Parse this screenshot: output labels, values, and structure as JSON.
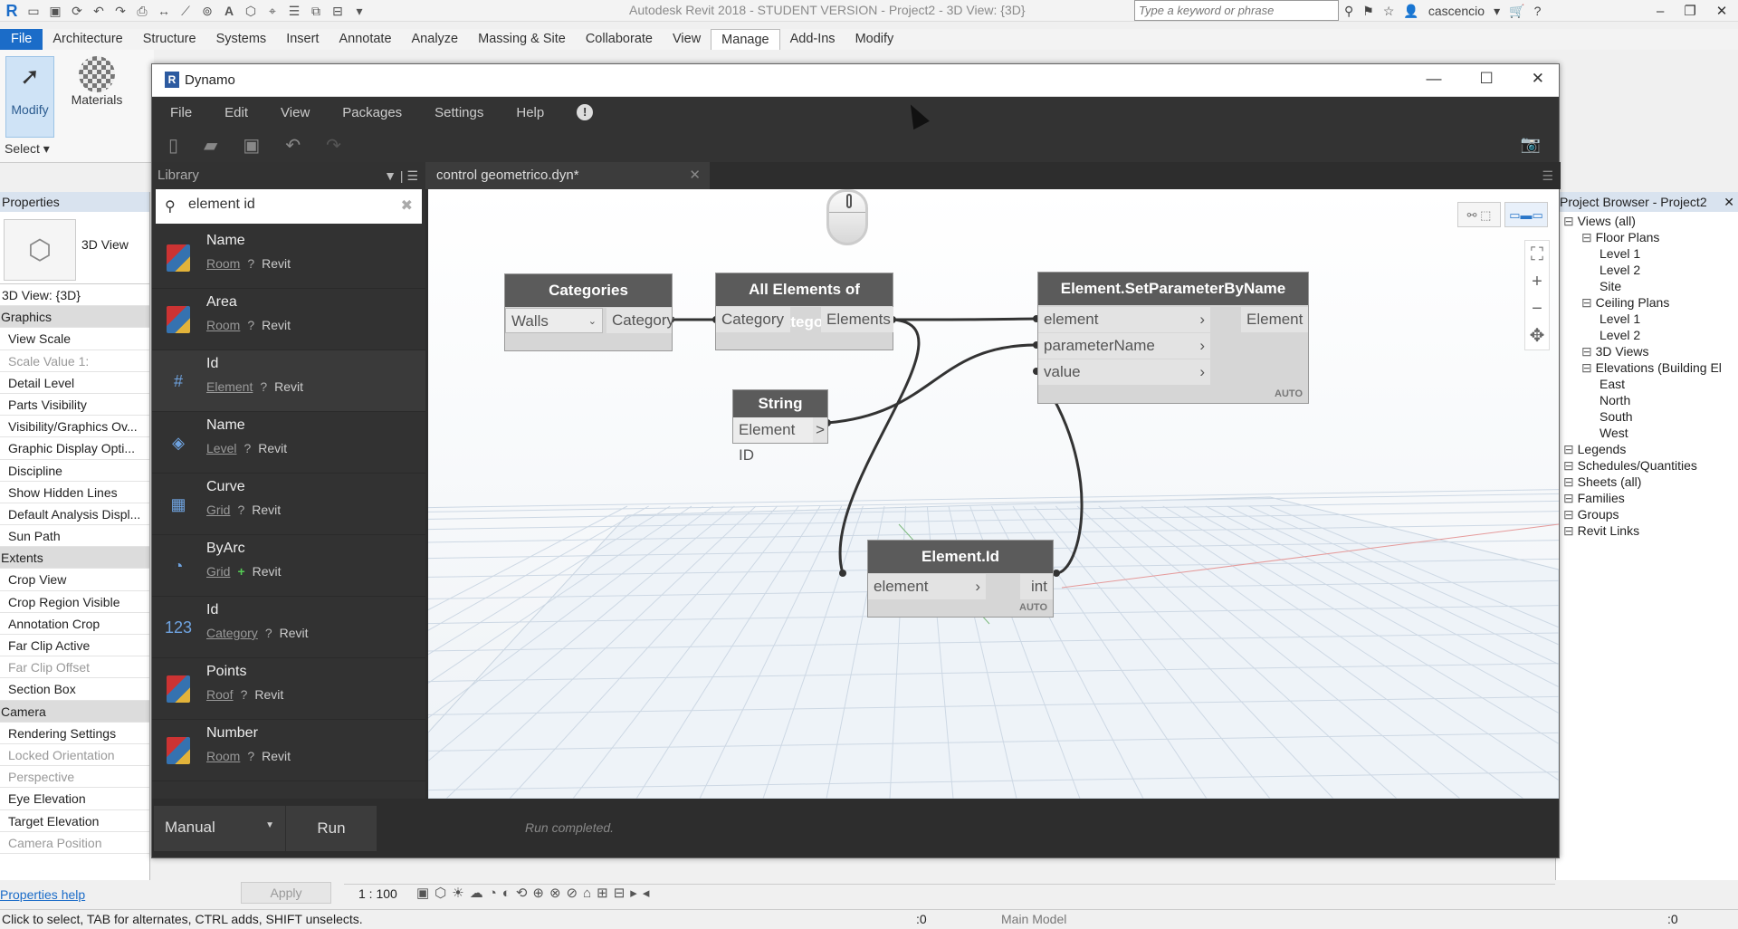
{
  "revit": {
    "title": "Autodesk Revit 2018 - STUDENT VERSION -     Project2 - 3D View: {3D}",
    "search_placeholder": "Type a keyword or phrase",
    "user": "cascencio",
    "tabs": [
      "File",
      "Architecture",
      "Structure",
      "Systems",
      "Insert",
      "Annotate",
      "Analyze",
      "Massing & Site",
      "Collaborate",
      "View",
      "Manage",
      "Add-Ins",
      "Modify"
    ],
    "active_tab": "Manage",
    "ribbon": {
      "modify": "Modify",
      "materials": "Materials",
      "select": "Select"
    },
    "properties": {
      "header": "Properties",
      "type_name": "3D View",
      "instance": "3D View: {3D}",
      "rows": [
        {
          "label": "Graphics",
          "kind": "cat"
        },
        {
          "label": "View Scale",
          "kind": "row"
        },
        {
          "label": "Scale Value    1:",
          "kind": "dim"
        },
        {
          "label": "Detail Level",
          "kind": "row"
        },
        {
          "label": "Parts Visibility",
          "kind": "row"
        },
        {
          "label": "Visibility/Graphics Ov...",
          "kind": "row"
        },
        {
          "label": "Graphic Display Opti...",
          "kind": "row"
        },
        {
          "label": "Discipline",
          "kind": "row"
        },
        {
          "label": "Show Hidden Lines",
          "kind": "row"
        },
        {
          "label": "Default Analysis Displ...",
          "kind": "row"
        },
        {
          "label": "Sun Path",
          "kind": "row"
        },
        {
          "label": "Extents",
          "kind": "cat"
        },
        {
          "label": "Crop View",
          "kind": "row"
        },
        {
          "label": "Crop Region Visible",
          "kind": "row"
        },
        {
          "label": "Annotation Crop",
          "kind": "row"
        },
        {
          "label": "Far Clip Active",
          "kind": "row"
        },
        {
          "label": "Far Clip Offset",
          "kind": "dim"
        },
        {
          "label": "Section Box",
          "kind": "row"
        },
        {
          "label": "Camera",
          "kind": "cat"
        },
        {
          "label": "Rendering Settings",
          "kind": "row"
        },
        {
          "label": "Locked Orientation",
          "kind": "dim"
        },
        {
          "label": "Perspective",
          "kind": "dim"
        },
        {
          "label": "Eye Elevation",
          "kind": "row"
        },
        {
          "label": "Target Elevation",
          "kind": "row"
        },
        {
          "label": "Camera Position",
          "kind": "dim"
        }
      ],
      "help": "Properties help",
      "apply": "Apply"
    },
    "browser": {
      "header": "Project Browser - Project2",
      "items": [
        {
          "label": "Views (all)",
          "level": 0
        },
        {
          "label": "Floor Plans",
          "level": 1
        },
        {
          "label": "Level 1",
          "level": 2
        },
        {
          "label": "Level 2",
          "level": 2
        },
        {
          "label": "Site",
          "level": 2
        },
        {
          "label": "Ceiling Plans",
          "level": 1
        },
        {
          "label": "Level 1",
          "level": 2
        },
        {
          "label": "Level 2",
          "level": 2
        },
        {
          "label": "3D Views",
          "level": 1
        },
        {
          "label": "Elevations (Building El",
          "level": 1
        },
        {
          "label": "East",
          "level": 2
        },
        {
          "label": "North",
          "level": 2
        },
        {
          "label": "South",
          "level": 2
        },
        {
          "label": "West",
          "level": 2
        },
        {
          "label": "Legends",
          "level": 0
        },
        {
          "label": "Schedules/Quantities",
          "level": 0
        },
        {
          "label": "Sheets (all)",
          "level": 0
        },
        {
          "label": "Families",
          "level": 0
        },
        {
          "label": "Groups",
          "level": 0
        },
        {
          "label": "Revit Links",
          "level": 0
        }
      ]
    },
    "viewbar_scale": "1 : 100",
    "status": "Click to select, TAB for alternates, CTRL adds, SHIFT unselects.",
    "status_model": "Main Model",
    "status_count": ":0",
    "status_filter": ":0"
  },
  "dynamo": {
    "title": "Dynamo",
    "menu": [
      "File",
      "Edit",
      "View",
      "Packages",
      "Settings",
      "Help"
    ],
    "library_label": "Library",
    "search_value": "element id",
    "results": [
      {
        "name": "Name",
        "category": "Room",
        "kind": "?",
        "source": "Revit"
      },
      {
        "name": "Area",
        "category": "Room",
        "kind": "?",
        "source": "Revit"
      },
      {
        "name": "Id",
        "category": "Element",
        "kind": "?",
        "source": "Revit"
      },
      {
        "name": "Name",
        "category": "Level",
        "kind": "?",
        "source": "Revit"
      },
      {
        "name": "Curve",
        "category": "Grid",
        "kind": "?",
        "source": "Revit"
      },
      {
        "name": "ByArc",
        "category": "Grid",
        "kind": "+",
        "source": "Revit"
      },
      {
        "name": "Id",
        "category": "Category",
        "kind": "?",
        "source": "Revit"
      },
      {
        "name": "Points",
        "category": "Roof",
        "kind": "?",
        "source": "Revit"
      },
      {
        "name": "Number",
        "category": "Room",
        "kind": "?",
        "source": "Revit"
      }
    ],
    "tab": "control geometrico.dyn*",
    "nodes": {
      "categories": {
        "title": "Categories",
        "value": "Walls",
        "out": "Category"
      },
      "all_elements": {
        "title": "All Elements of Category",
        "in": "Category",
        "out": "Elements"
      },
      "string": {
        "title": "String",
        "value": "Element ID",
        "out": ">"
      },
      "set_param": {
        "title": "Element.SetParameterByName",
        "in": [
          "element",
          "parameterName",
          "value"
        ],
        "out": "Element",
        "auto": "AUTO"
      },
      "element_id": {
        "title": "Element.Id",
        "in": "element",
        "out": "int",
        "auto": "AUTO"
      }
    },
    "run_mode": "Manual",
    "run": "Run",
    "status": "Run completed."
  }
}
